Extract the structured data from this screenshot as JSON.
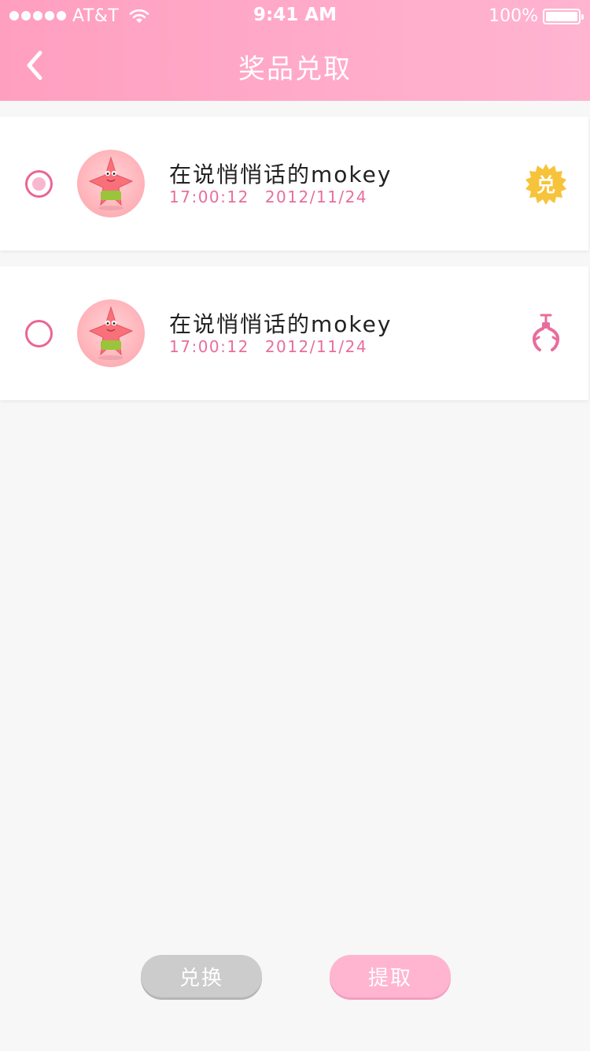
{
  "status_bar": {
    "carrier": "AT&T",
    "time": "9:41 AM",
    "battery": "100%"
  },
  "nav": {
    "title": "奖品兑取",
    "back_icon": "chevron-left-icon"
  },
  "prizes": [
    {
      "name": "在说悄悄话的mokey",
      "time": "17:00:12",
      "date": "2012/11/24",
      "selected": true,
      "badge_icon": "exchange-badge-icon",
      "badge_text": "兑"
    },
    {
      "name": "在说悄悄话的mokey",
      "time": "17:00:12",
      "date": "2012/11/24",
      "selected": false,
      "badge_icon": "claw-icon"
    }
  ],
  "actions": {
    "exchange_label": "兑换",
    "pickup_label": "提取"
  },
  "colors": {
    "header_start": "#ff9fc0",
    "header_end": "#ffb4d0",
    "accent_pink": "#ea6596",
    "badge_gold": "#f7c33a",
    "exchange_button": "#cccccc",
    "pickup_button": "#ffb5d0"
  }
}
